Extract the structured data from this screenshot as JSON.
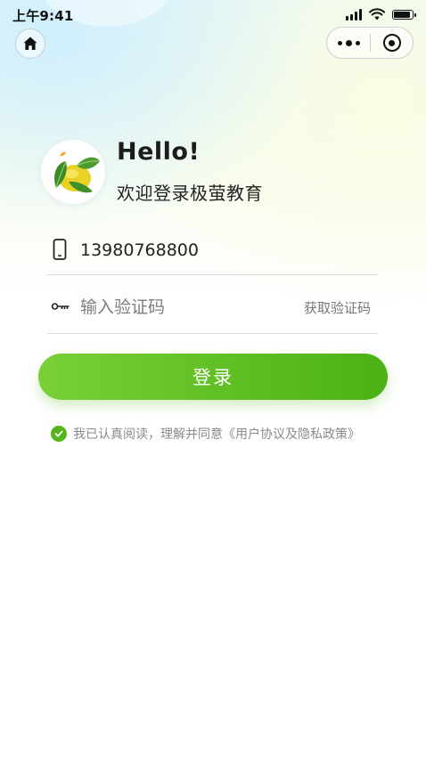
{
  "status_bar": {
    "time": "上午9:41"
  },
  "nav": {
    "home_icon": "home-icon",
    "more_icon": "more-dots-icon",
    "close_icon": "target-close-icon"
  },
  "header": {
    "greeting": "Hello!",
    "subtitle": "欢迎登录极萤教育"
  },
  "form": {
    "phone_value": "13980768800",
    "code_placeholder": "输入验证码",
    "get_code_label": "获取验证码",
    "login_label": "登录"
  },
  "agreement": {
    "checked": true,
    "text": "我已认真阅读，理解并同意《用户协议及隐私政策》"
  },
  "colors": {
    "accent": "#55b51d",
    "button_start": "#79d039",
    "button_end": "#4bb114"
  }
}
